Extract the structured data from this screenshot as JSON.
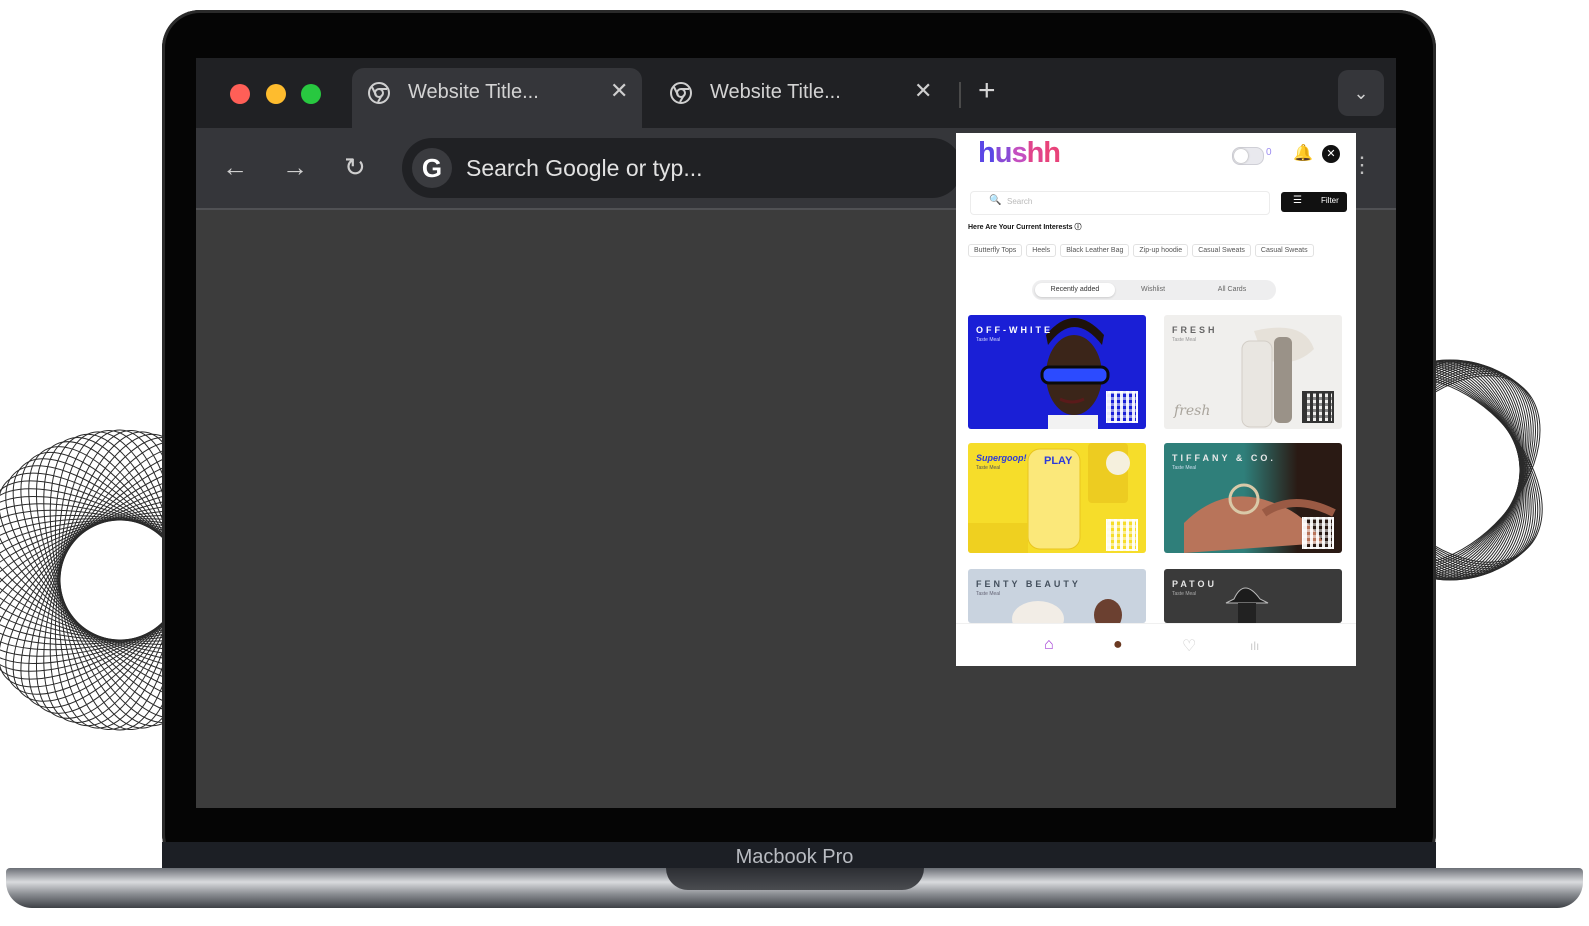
{
  "device": {
    "label": "Macbook Pro"
  },
  "browser": {
    "tabs": [
      {
        "title": "Website Title...",
        "close": "✕"
      },
      {
        "title": "Website Title...",
        "close": "✕"
      }
    ],
    "new_tab": "+",
    "tab_menu": "⌄",
    "toolbar": {
      "back": "←",
      "forward": "→",
      "reload": "↻",
      "google_glyph": "G",
      "omnibox_placeholder": "Search Google or typ..."
    },
    "extensions_menu": "⋮",
    "window_controls": {
      "close_color": "#ff5f57",
      "minimize_color": "#febc2e",
      "maximize_color": "#28c840"
    }
  },
  "extension": {
    "brand": {
      "h": "h",
      "u": "u",
      "s": "s",
      "h2": "h",
      "h3": "h"
    },
    "toggle_label": "0",
    "bell": "🔔",
    "close": "✕",
    "search": {
      "icon": "🔍",
      "placeholder": "Search"
    },
    "filter": {
      "icon": "☰",
      "label": "Filter"
    },
    "interests_heading": "Here Are Your Current Interests ⓘ",
    "interests": [
      "Butterfly Tops",
      "Heels",
      "Black Leather Bag",
      "Zip-up hoodie",
      "Casual Sweats",
      "Casual Sweats"
    ],
    "segments": [
      {
        "label": "Recently added",
        "active": true
      },
      {
        "label": "Wishlist",
        "active": false
      },
      {
        "label": "All Cards",
        "active": false
      }
    ],
    "cards": [
      {
        "brand": "OFF-WHITE",
        "sub": "Taste Meal",
        "bg": "#1a1fd6"
      },
      {
        "brand": "FRESH",
        "sub": "Taste Meal",
        "bg": "#f0efed",
        "script": "fresh"
      },
      {
        "brand": "Supergoop!",
        "sub": "Taste Meal",
        "bg": "#f6dd2a",
        "product": "PLAY"
      },
      {
        "brand": "TIFFANY & CO.",
        "sub": "Taste Meal",
        "bg": "#2f7f7a"
      },
      {
        "brand": "FENTY BEAUTY",
        "sub": "Taste Meal",
        "bg": "#c9d3df"
      },
      {
        "brand": "PATOU",
        "sub": "Taste Meal",
        "bg": "#3a3a3a"
      }
    ],
    "bottom_nav": {
      "home": "⌂",
      "profile": "●",
      "wishlist": "♡",
      "stats": "ılı"
    }
  }
}
